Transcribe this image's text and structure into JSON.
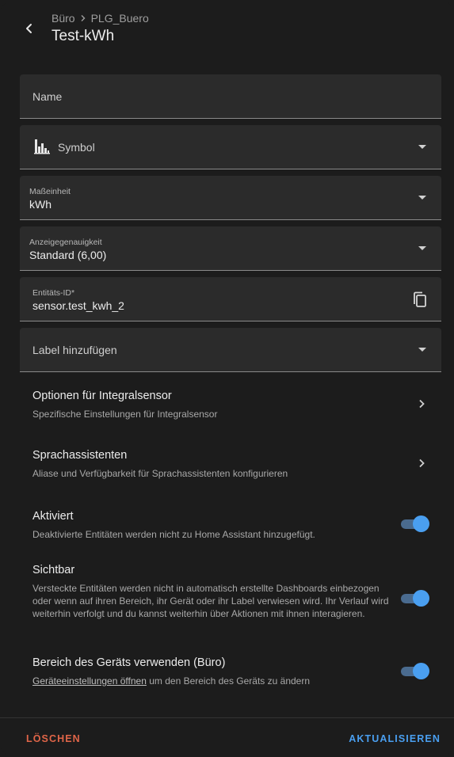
{
  "header": {
    "breadcrumb": [
      "Büro",
      "PLG_Buero"
    ],
    "title": "Test-kWh"
  },
  "fields": {
    "name": {
      "placeholder": "Name"
    },
    "symbol": {
      "placeholder": "Symbol",
      "icon": "chart-bar-stacked-icon"
    },
    "unit": {
      "label": "Maßeinheit",
      "value": "kWh"
    },
    "precision": {
      "label": "Anzeigegenauigkeit",
      "value": "Standard (6,00)"
    },
    "entity_id": {
      "label": "Entitäts-ID*",
      "prefix": "sensor.",
      "value": "test_kwh_2"
    },
    "labels": {
      "placeholder": "Label hinzufügen"
    }
  },
  "nav_rows": [
    {
      "title": "Optionen für Integralsensor",
      "subtitle": "Spezifische Einstellungen für Integralsensor"
    },
    {
      "title": "Sprachassistenten",
      "subtitle": "Aliase und Verfügbarkeit für Sprachassistenten konfigurieren"
    }
  ],
  "toggles": [
    {
      "title": "Aktiviert",
      "subtitle": "Deaktivierte Entitäten werden nicht zu Home Assistant hinzugefügt.",
      "checked": true
    },
    {
      "title": "Sichtbar",
      "subtitle": "Versteckte Entitäten werden nicht in automatisch erstellte Dashboards einbezogen oder wenn auf ihren Bereich, ihr Gerät oder ihr Label verwiesen wird. Ihr Verlauf wird weiterhin verfolgt und du kannst weiterhin über Aktionen mit ihnen interagieren.",
      "checked": true
    },
    {
      "title": "Bereich des Geräts verwenden (Büro)",
      "link": "Geräteeinstellungen öffnen",
      "subtitle_rest": " um den Bereich des Geräts zu ändern",
      "checked": true
    }
  ],
  "footer": {
    "delete_label": "LÖSCHEN",
    "update_label": "AKTUALISIEREN"
  },
  "colors": {
    "accent": "#4a9ff0",
    "danger": "#e06548",
    "surface": "#2b2b2b",
    "background": "#1c1c1c"
  }
}
